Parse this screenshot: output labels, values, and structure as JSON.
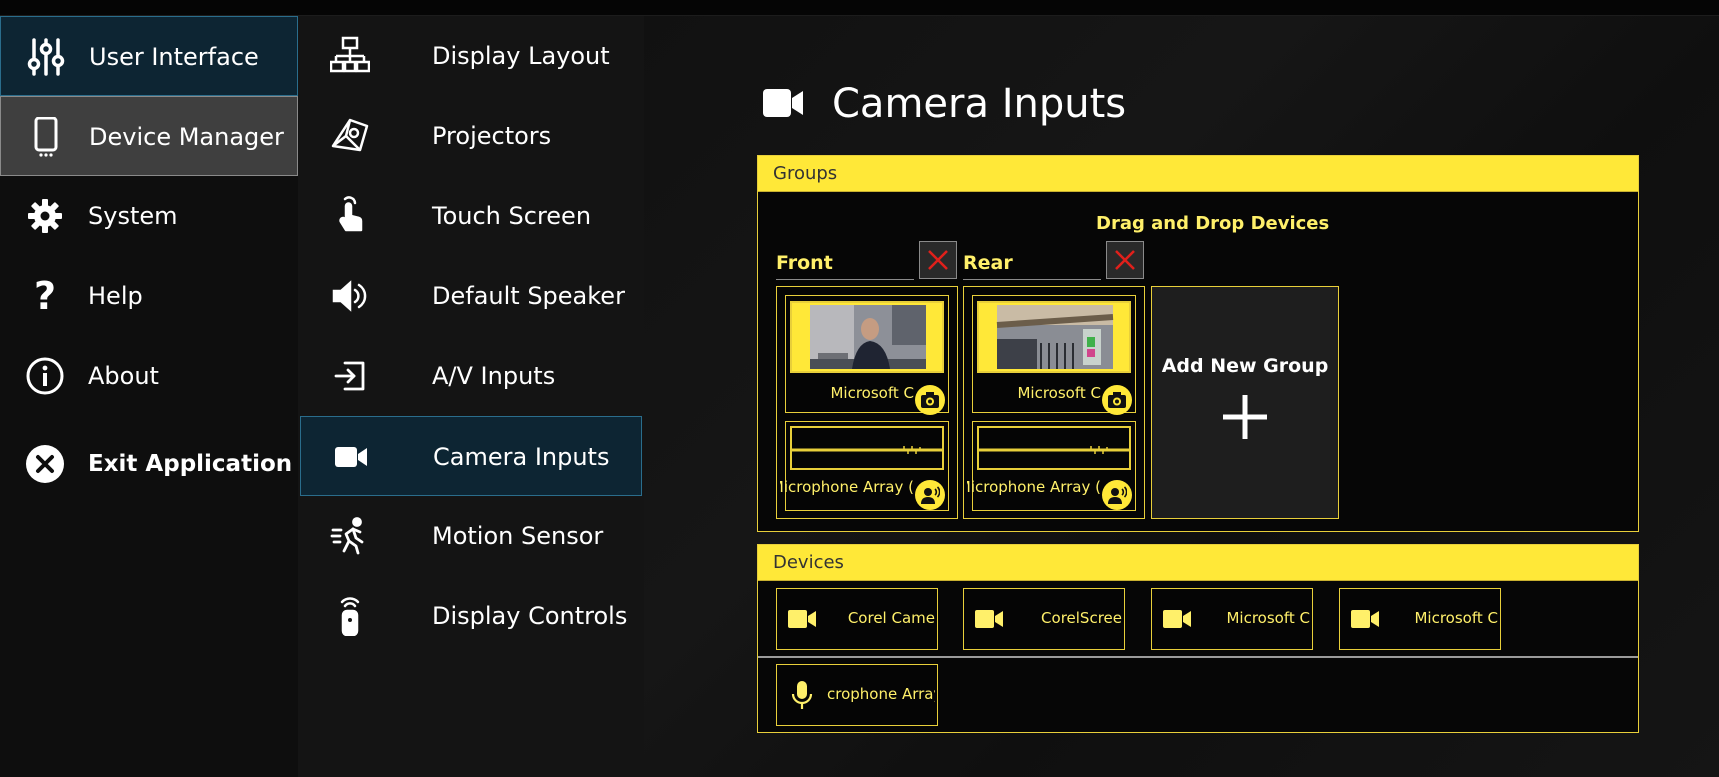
{
  "sidebar": {
    "items": [
      {
        "label": "User Interface",
        "icon": "sliders-icon"
      },
      {
        "label": "Device Manager",
        "icon": "phone-icon"
      },
      {
        "label": "System",
        "icon": "gear-icon"
      },
      {
        "label": "Help",
        "icon": "question-icon"
      },
      {
        "label": "About",
        "icon": "info-icon"
      },
      {
        "label": "Exit Application",
        "icon": "close-circle-icon"
      }
    ]
  },
  "subnav": {
    "items": [
      {
        "label": "Display Layout",
        "icon": "network-icon"
      },
      {
        "label": "Projectors",
        "icon": "projector-icon"
      },
      {
        "label": "Touch Screen",
        "icon": "touch-icon"
      },
      {
        "label": "Default Speaker",
        "icon": "speaker-icon"
      },
      {
        "label": "A/V Inputs",
        "icon": "input-icon"
      },
      {
        "label": "Camera Inputs",
        "icon": "video-camera-icon"
      },
      {
        "label": "Motion Sensor",
        "icon": "running-person-icon"
      },
      {
        "label": "Display Controls",
        "icon": "remote-icon"
      }
    ]
  },
  "page": {
    "title": "Camera Inputs"
  },
  "groups_panel": {
    "header": "Groups",
    "drag_hint": "Drag and Drop Devices",
    "groups": [
      {
        "name": "Front",
        "camera_label": "Microsoft C",
        "mic_label": "Microphone Array ("
      },
      {
        "name": "Rear",
        "camera_label": "Microsoft C",
        "mic_label": "Microphone Array ("
      }
    ],
    "add_group_label": "Add New Group"
  },
  "devices_panel": {
    "header": "Devices",
    "devices": [
      {
        "label": "Corel Came",
        "icon": "video-camera-icon"
      },
      {
        "label": "CorelScree",
        "icon": "video-camera-icon"
      },
      {
        "label": "Microsoft C",
        "icon": "video-camera-icon"
      },
      {
        "label": "Microsoft C",
        "icon": "video-camera-icon"
      },
      {
        "label": "crophone Array (R",
        "icon": "microphone-icon"
      }
    ]
  },
  "colors": {
    "accent_yellow": "#ffe838",
    "label_yellow": "#fff06a",
    "active_blue": "#0d2533",
    "delete_red": "#e0201b"
  }
}
